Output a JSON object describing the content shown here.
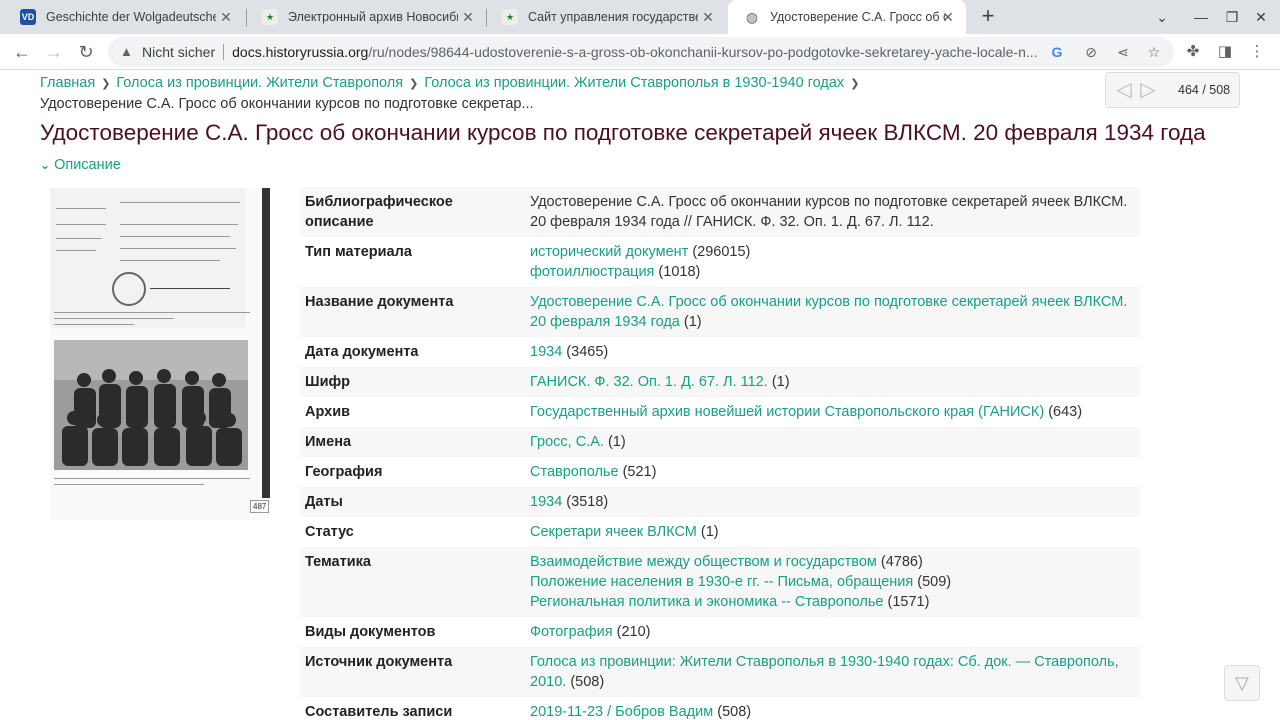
{
  "tabs": [
    {
      "label": "Geschichte der Wolgadeutschen",
      "favicon": "VD",
      "favicon_color": "#1f4fa3"
    },
    {
      "label": "Электронный архив Новосибирской",
      "favicon": "★",
      "favicon_color": "#2e7d32"
    },
    {
      "label": "Сайт управления государственной",
      "favicon": "★",
      "favicon_color": "#2e7d32"
    },
    {
      "label": "Удостоверение С.А. Гросс об о",
      "favicon": "globe-icon",
      "favicon_color": "#5f6368"
    }
  ],
  "toolbar": {
    "security_label": "Nicht sicher",
    "url_host": "docs.historyrussia.org",
    "url_path": "/ru/nodes/98644-udostoverenie-s-a-gross-ob-okonchanii-kursov-po-podgotovke-sekretarey-yache-locale-n..."
  },
  "breadcrumb": {
    "items": [
      "Главная",
      "Голоса из провинции. Жители Ставрополя",
      "Голоса из провинции. Жители Ставрополья в 1930-1940 годах"
    ],
    "current": "Удостоверение С.А. Гросс об окончании курсов по подготовке секретар..."
  },
  "pager": {
    "position": "464 / 508"
  },
  "page_title": "Удостоверение С.А. Гросс об окончании курсов по подготовке секретарей ячеек ВЛКСМ. 20 февраля 1934 года",
  "description_toggle": "Описание",
  "thumbnail": {
    "page_number": "487"
  },
  "rows": [
    {
      "key": "Библиографическое описание",
      "plain": "Удостоверение С.А. Гросс об окончании курсов по подготовке секретарей ячеек ВЛКСМ. 20 февраля 1934 года // ГАНИСК. Ф. 32. Оп. 1. Д. 67. Л. 112."
    },
    {
      "key": "Тип материала",
      "links": [
        {
          "text": "исторический документ",
          "count": "(296015)"
        },
        {
          "text": "фотоиллюстрация",
          "count": "(1018)"
        }
      ]
    },
    {
      "key": "Название документа",
      "links": [
        {
          "text": "Удостоверение С.А. Гросс об окончании курсов по подготовке секретарей ячеек ВЛКСМ. 20 февраля 1934 года",
          "count": "(1)"
        }
      ]
    },
    {
      "key": "Дата документа",
      "links": [
        {
          "text": "1934",
          "count": "(3465)"
        }
      ]
    },
    {
      "key": "Шифр",
      "links": [
        {
          "text": "ГАНИСК. Ф. 32. Оп. 1. Д. 67. Л. 112.",
          "count": "(1)"
        }
      ]
    },
    {
      "key": "Архив",
      "links": [
        {
          "text": "Государственный архив новейшей истории Ставропольского края (ГАНИСК)",
          "count": "(643)"
        }
      ]
    },
    {
      "key": "Имена",
      "links": [
        {
          "text": "Гросс, С.А.",
          "count": "(1)"
        }
      ]
    },
    {
      "key": "География",
      "links": [
        {
          "text": "Ставрополье",
          "count": "(521)"
        }
      ]
    },
    {
      "key": "Даты",
      "links": [
        {
          "text": "1934",
          "count": "(3518)"
        }
      ]
    },
    {
      "key": "Статус",
      "links": [
        {
          "text": "Секретари ячеек ВЛКСМ",
          "count": "(1)"
        }
      ]
    },
    {
      "key": "Тематика",
      "links": [
        {
          "text": "Взаимодействие между обществом и государством",
          "count": "(4786)"
        },
        {
          "text": "Положение населения в 1930-е гг. -- Письма, обращения",
          "count": "(509)"
        },
        {
          "text": "Региональная политика и экономика -- Ставрополье",
          "count": "(1571)"
        }
      ]
    },
    {
      "key": "Виды документов",
      "links": [
        {
          "text": "Фотография",
          "count": "(210)"
        }
      ]
    },
    {
      "key": "Источник документа",
      "links": [
        {
          "text": "Голоса из провинции: Жители Ставрополья в 1930-1940 годах: Сб. док. — Ставрополь, 2010.",
          "count": "(508)"
        }
      ]
    },
    {
      "key": "Составитель записи",
      "links": [
        {
          "text": "2019-11-23 / Бобров Вадим",
          "count": "(508)"
        }
      ]
    }
  ],
  "colors": {
    "link": "#16a085",
    "title": "#4a1020"
  }
}
